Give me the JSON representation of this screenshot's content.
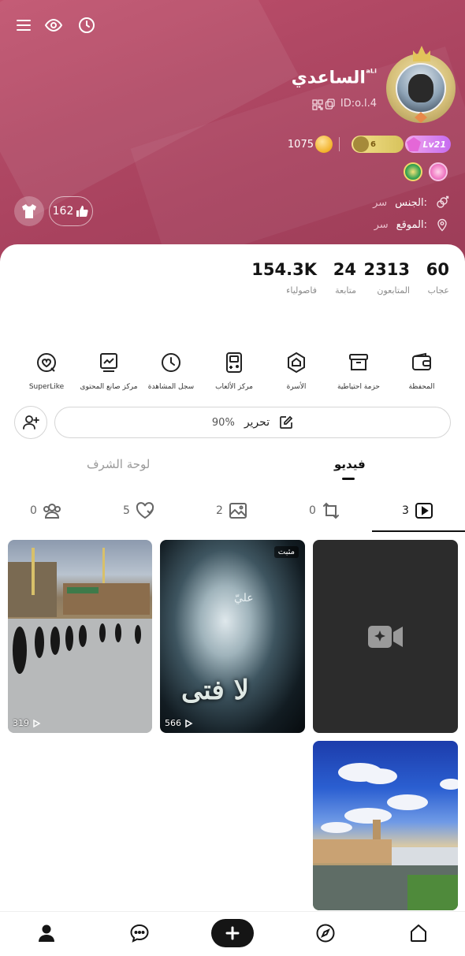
{
  "profile": {
    "name": "الساعدي",
    "name_tag": "ᵃᴸⁱ",
    "id_text": "ID:o.l.4",
    "level": "Lv21",
    "family_badge": "6",
    "coins": "1075",
    "likes": "162"
  },
  "info": {
    "gender_label": "الجنس:",
    "gender_value": "سر",
    "location_label": "الموقع:",
    "location_value": "سر"
  },
  "stats": [
    {
      "value": "60",
      "label": "عجاب"
    },
    {
      "value": "2313",
      "label": "المتابعون"
    },
    {
      "value": "24",
      "label": "متابعة"
    },
    {
      "value": "154.3K",
      "label": "فاصولياء"
    }
  ],
  "tools": [
    {
      "label": "المحفظة",
      "icon": "wallet-icon"
    },
    {
      "label": "حزمة احتياطية",
      "icon": "backpack-icon"
    },
    {
      "label": "الأسرة",
      "icon": "family-icon"
    },
    {
      "label": "مركز الألعاب",
      "icon": "gamepad-icon"
    },
    {
      "label": "سجل المشاهدة",
      "icon": "clock-icon"
    },
    {
      "label": "مركز صانع المحتوى",
      "icon": "chart-icon"
    },
    {
      "label": "SuperLike",
      "icon": "superlike-icon"
    }
  ],
  "edit": {
    "label": "تحرير",
    "percent": "90%"
  },
  "tabs": {
    "video": "فيديو",
    "honor": "لوحة الشرف"
  },
  "subtabs": [
    {
      "count": "3",
      "icon": "video-play-icon"
    },
    {
      "count": "0",
      "icon": "repost-icon"
    },
    {
      "count": "2",
      "icon": "image-icon"
    },
    {
      "count": "5",
      "icon": "liked-icon"
    },
    {
      "count": "0",
      "icon": "group-icon"
    }
  ],
  "videos": {
    "pinned_label": "مثبت",
    "pinned_plays": "566",
    "pinned_overlay": "لا فتى",
    "pinned_overlay_small": "عليّ",
    "shrine_plays": "319"
  },
  "colors": {
    "header": "#b04864",
    "accent": "#111111"
  }
}
